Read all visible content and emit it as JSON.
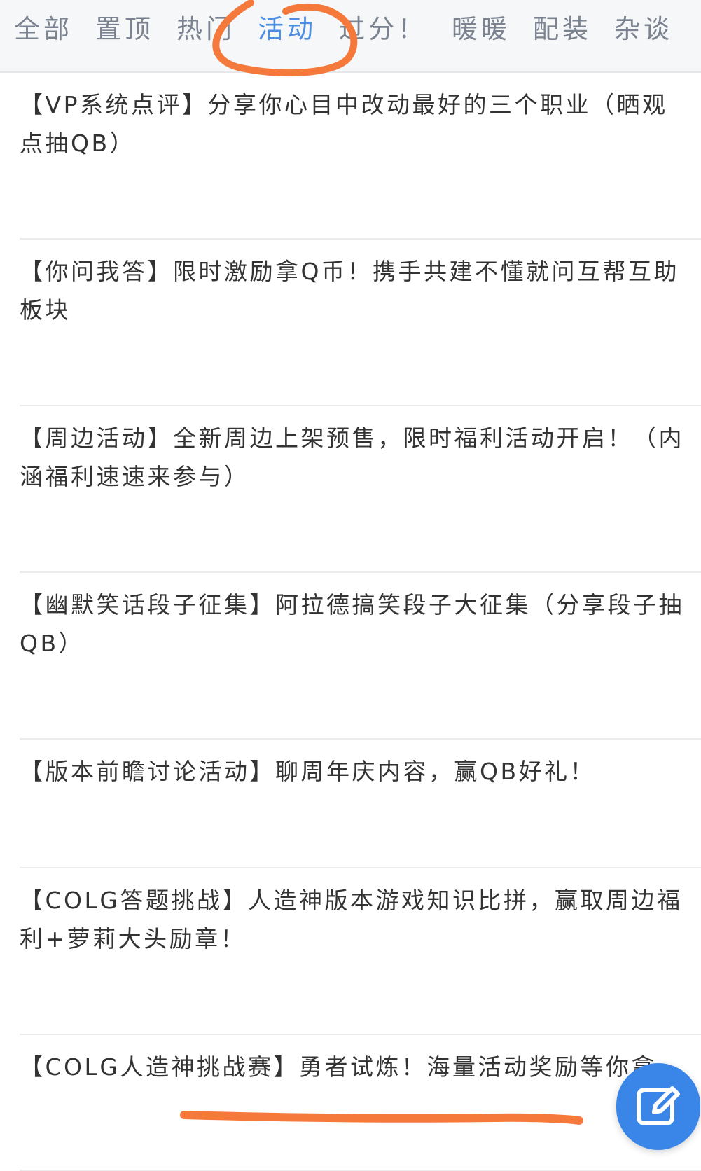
{
  "tabs": [
    {
      "label": "全部"
    },
    {
      "label": "置顶"
    },
    {
      "label": "热门"
    },
    {
      "label": "活动"
    },
    {
      "label": "过分！"
    },
    {
      "label": "暖暖"
    },
    {
      "label": "配装"
    },
    {
      "label": "杂谈"
    }
  ],
  "active_tab": "活动",
  "posts": [
    {
      "title": "【VP系统点评】分享你心目中改动最好的三个职业（晒观点抽QB）"
    },
    {
      "title": "【你问我答】限时激励拿Q币！携手共建不懂就问互帮互助板块"
    },
    {
      "title": "【周边活动】全新周边上架预售，限时福利活动开启！（内涵福利速速来参与）"
    },
    {
      "title": "【幽默笑话段子征集】阿拉德搞笑段子大征集（分享段子抽QB）"
    },
    {
      "title": "【版本前瞻讨论活动】聊周年庆内容，赢QB好礼！"
    },
    {
      "title": "【COLG答题挑战】人造神版本游戏知识比拼，赢取周边福利+萝莉大头励章！"
    },
    {
      "title": "【COLG人造神挑战赛】勇者试炼！海量活动奖励等你拿"
    }
  ],
  "colors": {
    "accent": "#4b8ee3",
    "annotation": "#f5793b",
    "fab": "#3a86e8"
  },
  "icons": {
    "fab": "edit-icon"
  }
}
